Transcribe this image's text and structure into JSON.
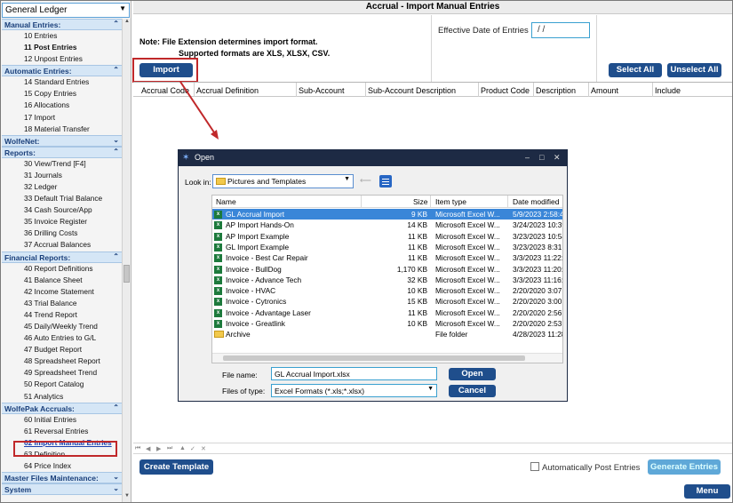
{
  "sidebar": {
    "selector": "General Ledger",
    "sections": [
      {
        "title": "Manual Entries:",
        "chevron": "up",
        "items": [
          {
            "label": "10 Entries"
          },
          {
            "label": "11 Post Entries",
            "bold": true
          },
          {
            "label": "12 Unpost Entries"
          }
        ]
      },
      {
        "title": "Automatic Entries:",
        "chevron": "up",
        "items": [
          {
            "label": "14 Standard Entries"
          },
          {
            "label": "15 Copy Entries"
          },
          {
            "label": "16 Allocations"
          },
          {
            "label": "17 Import"
          },
          {
            "label": "18 Material Transfer"
          }
        ]
      },
      {
        "title": "WolfeNet:",
        "chevron": "down",
        "items": []
      },
      {
        "title": "Reports:",
        "chevron": "up",
        "items": [
          {
            "label": "30 View/Trend  [F4]"
          },
          {
            "label": "31 Journals"
          },
          {
            "label": "32 Ledger"
          },
          {
            "label": "33 Default Trial Balance"
          },
          {
            "label": "34 Cash Source/App"
          },
          {
            "label": "35 Invoice Register"
          },
          {
            "label": "36 Drilling Costs"
          },
          {
            "label": "37 Accrual Balances"
          }
        ]
      },
      {
        "title": "Financial Reports:",
        "chevron": "up",
        "items": [
          {
            "label": "40 Report Definitions"
          },
          {
            "label": "41 Balance Sheet"
          },
          {
            "label": "42 Income Statement"
          },
          {
            "label": "43 Trial Balance"
          },
          {
            "label": "44 Trend Report"
          },
          {
            "label": "45 Daily/Weekly Trend"
          },
          {
            "label": "46 Auto Entries to G/L"
          },
          {
            "label": "47 Budget Report"
          },
          {
            "label": "48 Spreadsheet Report"
          },
          {
            "label": "49 Spreadsheet Trend"
          },
          {
            "label": "50 Report Catalog"
          },
          {
            "label": "51 Analytics"
          }
        ]
      },
      {
        "title": "WolfePak Accruals:",
        "chevron": "up",
        "items": [
          {
            "label": "60 Initial Entries"
          },
          {
            "label": "61 Reversal Entries"
          },
          {
            "label": "62 Import Manual Entries",
            "selected": true
          },
          {
            "label": "63 Definition"
          },
          {
            "label": "64 Price Index"
          }
        ]
      },
      {
        "title": "Master Files Maintenance:",
        "chevron": "down",
        "items": []
      },
      {
        "title": "System",
        "chevron": "down",
        "items": []
      }
    ]
  },
  "main": {
    "title": "Accrual - Import Manual Entries",
    "note_line1": "Note: File Extension determines import format.",
    "note_line2": "Supported formats are XLS, XLSX, CSV.",
    "effective_date_label": "Effective Date of Entries",
    "effective_date_value": "/  /",
    "import_button": "Import",
    "select_all": "Select All",
    "unselect_all": "Unselect All",
    "columns": [
      "Accrual Code",
      "Accrual Definition",
      "Sub-Account",
      "Sub-Account Description",
      "Product Code",
      "Description",
      "Amount",
      "Include"
    ],
    "create_template": "Create Template",
    "auto_post_label": "Automatically Post Entries",
    "generate_entries": "Generate Entries",
    "menu": "Menu"
  },
  "dialog": {
    "title": "Open",
    "look_in_label": "Look in:",
    "look_in_value": "Pictures and Templates",
    "headers": [
      "Name",
      "Size",
      "Item type",
      "Date modified"
    ],
    "files": [
      {
        "name": "GL Accrual Import",
        "size": "9 KB",
        "type": "Microsoft Excel W...",
        "date": "5/9/2023 2:58:42",
        "kind": "xl",
        "selected": true
      },
      {
        "name": "AP Import Hands-On",
        "size": "14 KB",
        "type": "Microsoft Excel W...",
        "date": "3/24/2023 10:39",
        "kind": "xl"
      },
      {
        "name": "AP Import Example",
        "size": "11 KB",
        "type": "Microsoft Excel W...",
        "date": "3/23/2023 10:54",
        "kind": "xl"
      },
      {
        "name": "GL Import Example",
        "size": "11 KB",
        "type": "Microsoft Excel W...",
        "date": "3/23/2023 8:31:0",
        "kind": "xl"
      },
      {
        "name": "Invoice - Best Car Repair",
        "size": "11 KB",
        "type": "Microsoft Excel W...",
        "date": "3/3/2023 11:22:1",
        "kind": "xl"
      },
      {
        "name": "Invoice - BullDog",
        "size": "1,170 KB",
        "type": "Microsoft Excel W...",
        "date": "3/3/2023 11:20:1",
        "kind": "xl"
      },
      {
        "name": "Invoice - Advance Tech",
        "size": "32 KB",
        "type": "Microsoft Excel W...",
        "date": "3/3/2023 11:16:3",
        "kind": "xl"
      },
      {
        "name": "Invoice - HVAC",
        "size": "10 KB",
        "type": "Microsoft Excel W...",
        "date": "2/20/2020 3:07:5",
        "kind": "xl"
      },
      {
        "name": "Invoice - Cytronics",
        "size": "15 KB",
        "type": "Microsoft Excel W...",
        "date": "2/20/2020 3:00:3",
        "kind": "xl"
      },
      {
        "name": "Invoice - Advantage Laser",
        "size": "11 KB",
        "type": "Microsoft Excel W...",
        "date": "2/20/2020 2:56:3",
        "kind": "xl"
      },
      {
        "name": "Invoice - Greatlink",
        "size": "10 KB",
        "type": "Microsoft Excel W...",
        "date": "2/20/2020 2:53:0",
        "kind": "xl"
      },
      {
        "name": "Archive",
        "size": "",
        "type": "File folder",
        "date": "4/28/2023 11:28",
        "kind": "folder"
      }
    ],
    "file_name_label": "File name:",
    "file_name_value": "GL Accrual Import.xlsx",
    "file_type_label": "Files of type:",
    "file_type_value": "Excel Formats (*.xls;*.xlsx)",
    "open": "Open",
    "cancel": "Cancel"
  },
  "colors": {
    "accent": "#1f4e8c",
    "highlight": "#c0282a",
    "section_bg": "#d5e6f6",
    "dialog_title": "#1d2a44"
  }
}
